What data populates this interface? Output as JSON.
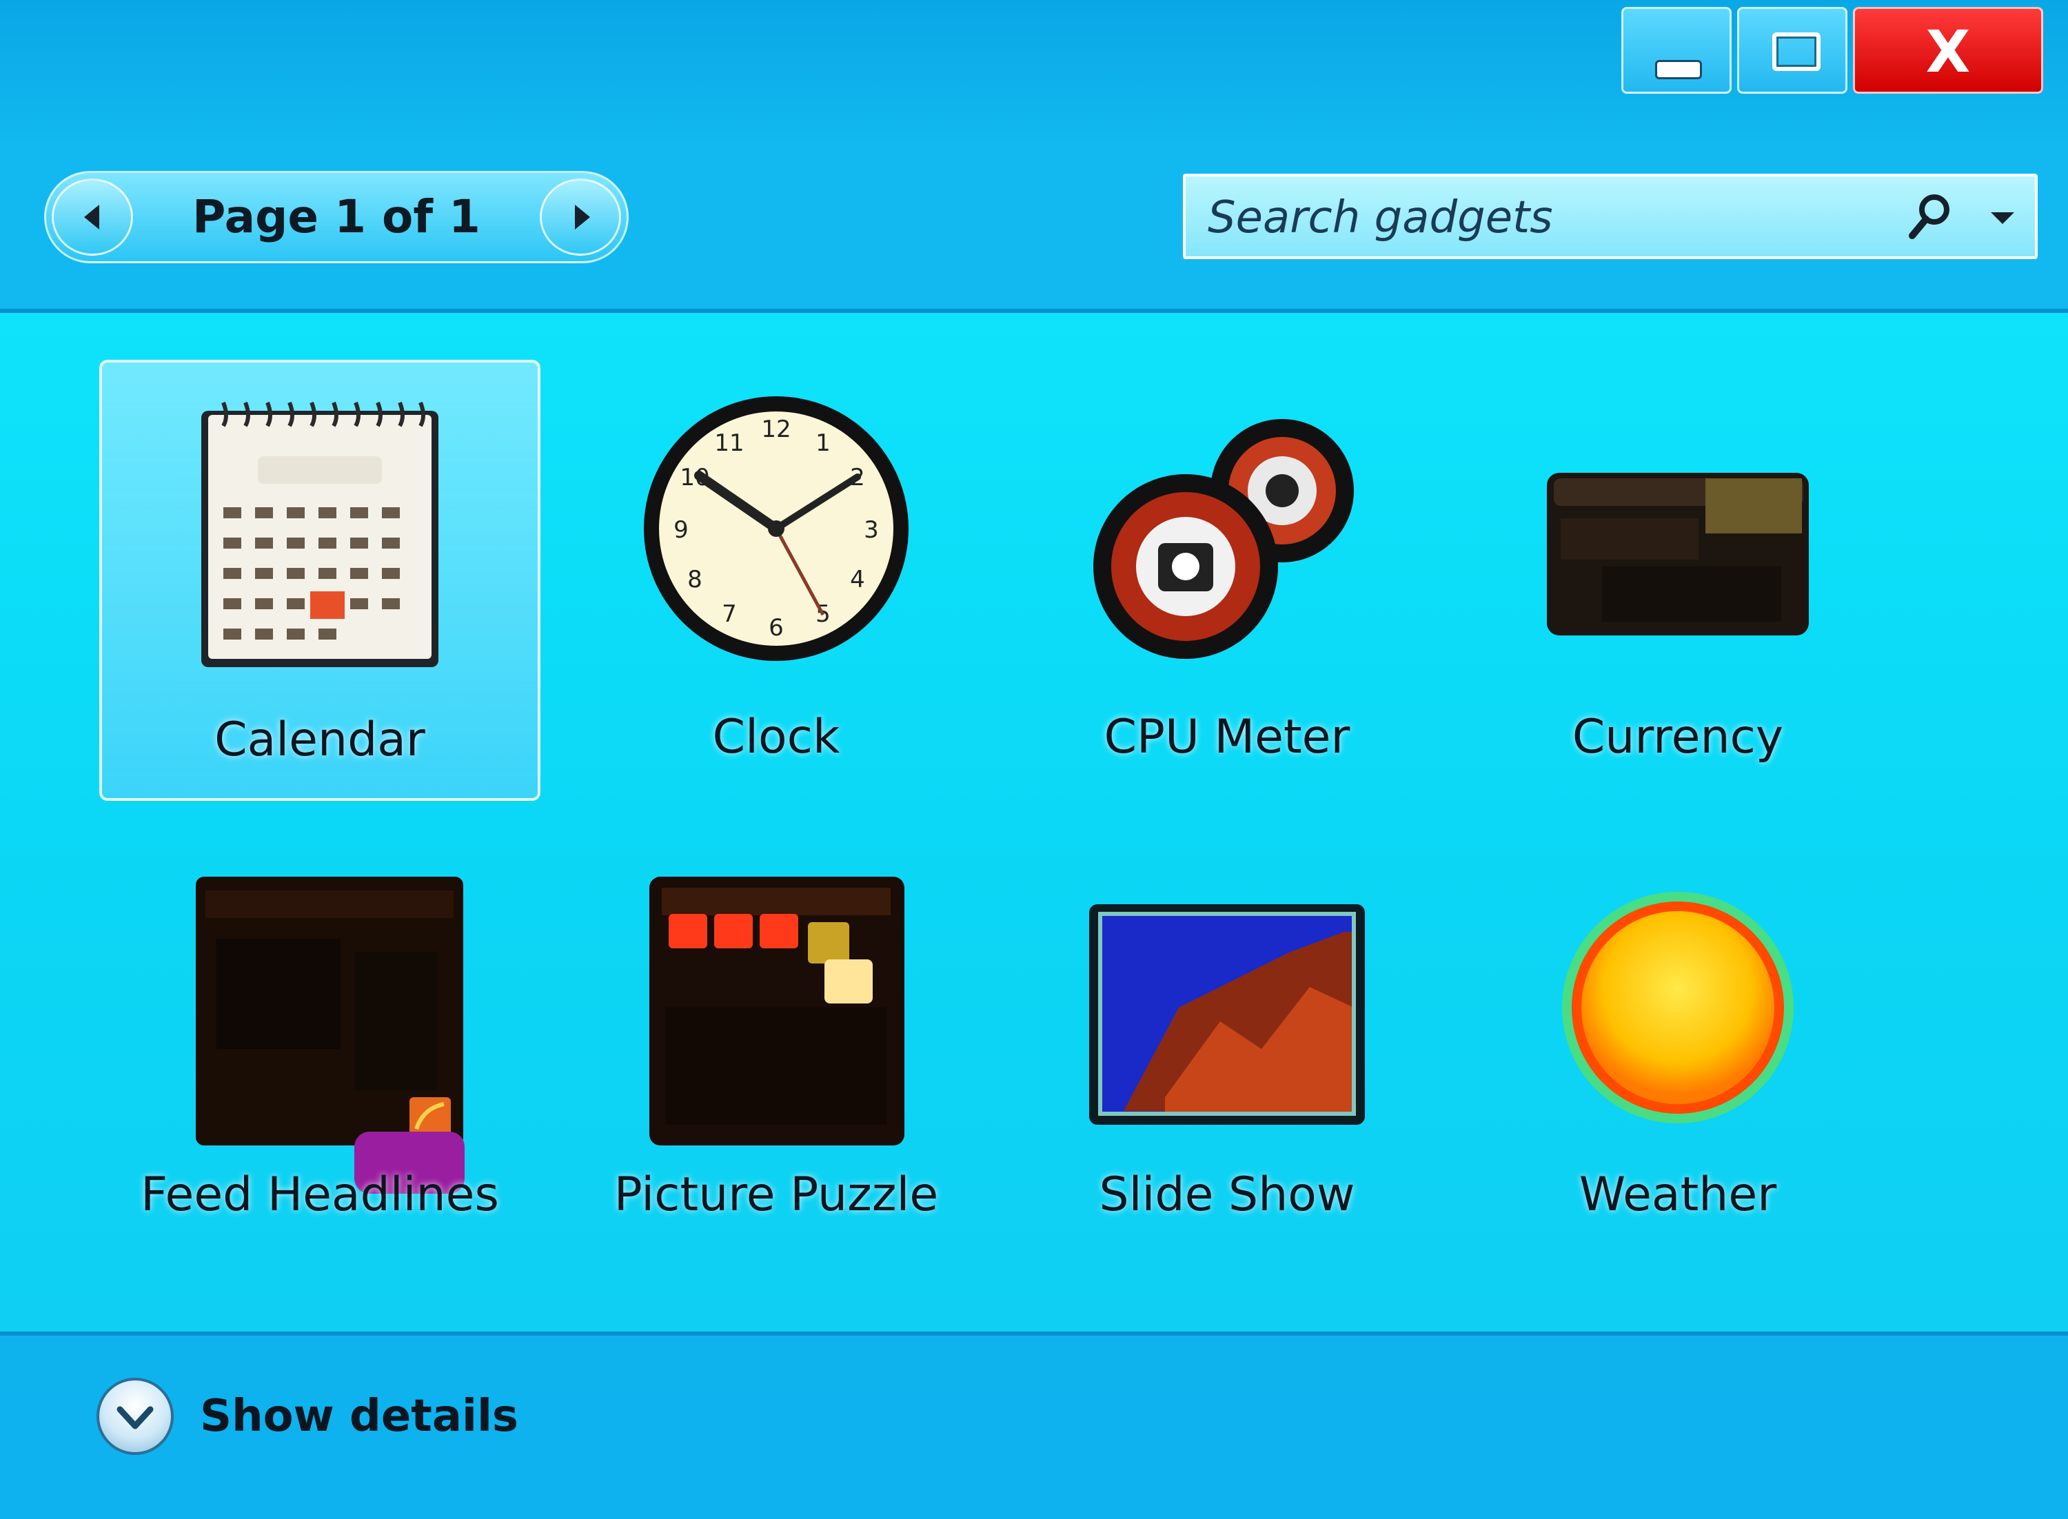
{
  "window": {
    "controls": {
      "minimize_icon": "minimize-icon",
      "maximize_icon": "maximize-icon",
      "close_icon": "close-icon",
      "close_glyph": "X"
    }
  },
  "toolbar": {
    "pager": {
      "label": "Page 1 of 1",
      "prev_icon": "chevron-left-icon",
      "next_icon": "chevron-right-icon"
    },
    "search": {
      "placeholder": "Search gadgets",
      "value": "",
      "icon": "search-icon",
      "dropdown_icon": "chevron-down-icon"
    }
  },
  "gadgets": [
    {
      "label": "Calendar",
      "icon": "calendar-icon",
      "selected": true
    },
    {
      "label": "Clock",
      "icon": "clock-icon",
      "selected": false
    },
    {
      "label": "CPU Meter",
      "icon": "cpu-meter-icon",
      "selected": false
    },
    {
      "label": "Currency",
      "icon": "currency-icon",
      "selected": false
    },
    {
      "label": "Feed Headlines",
      "icon": "feed-headlines-icon",
      "selected": false
    },
    {
      "label": "Picture Puzzle",
      "icon": "picture-puzzle-icon",
      "selected": false
    },
    {
      "label": "Slide Show",
      "icon": "slide-show-icon",
      "selected": false
    },
    {
      "label": "Weather",
      "icon": "weather-icon",
      "selected": false
    }
  ],
  "footer": {
    "show_details_label": "Show details",
    "show_details_icon": "chevron-down-circle-icon"
  },
  "colors": {
    "window_bg": "#0db2ee",
    "content_bg": "#0ee3fb",
    "close_red": "#e00000",
    "text": "#0b1620"
  }
}
